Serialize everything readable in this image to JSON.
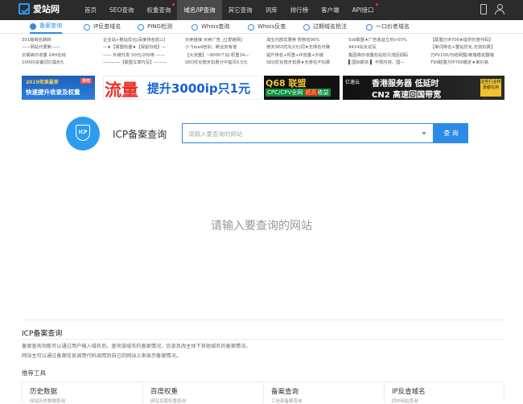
{
  "top_nav": {
    "logo_text": "爱站网",
    "items": [
      {
        "label": "首页",
        "active": false,
        "dot": false
      },
      {
        "label": "SEO查询",
        "active": false,
        "dot": false
      },
      {
        "label": "权重查询",
        "active": false,
        "dot": true
      },
      {
        "label": "域名/IP查询",
        "active": true,
        "dot": false
      },
      {
        "label": "其它查询",
        "active": false,
        "dot": false
      },
      {
        "label": "词库",
        "active": false,
        "dot": false
      },
      {
        "label": "排行榜",
        "active": false,
        "dot": false
      },
      {
        "label": "客户端",
        "active": false,
        "dot": false
      },
      {
        "label": "API接口",
        "active": false,
        "dot": true
      }
    ],
    "icons": [
      "phone-icon",
      "user-icon"
    ]
  },
  "sub_nav": {
    "items": [
      {
        "label": "备案查询",
        "active": true
      },
      {
        "label": "IP反查域名",
        "active": false
      },
      {
        "label": "PING检测",
        "active": false
      },
      {
        "label": "Whois查询",
        "active": false
      },
      {
        "label": "Whois反查",
        "active": false
      },
      {
        "label": "过期域名抢注",
        "active": false
      },
      {
        "label": "一口价老域名",
        "active": false
      }
    ]
  },
  "ad_links": {
    "columns": [
      [
        "301敞域名跳转",
        "——网站代更新——",
        "长期高价收量 24H在线",
        "10000关键词只需8元"
      ],
      [
        "企业站+整站优化[百度排名前三]",
        "—★【联盟收量★【保留日结】—",
        "—— 外链代发 50元/200条 ——",
        "————【联盟文章代写】———"
      ],
      [
        "买卖链接 买卖广告 上[爱链网]",
        "小飞lead培训、刷业务有道",
        "【大流量】~8000个站-权重34—",
        "SEO优化按天扣费分中首页0.5元"
      ],
      [
        "淘宝内部优惠券 购物省90%",
        "按天SEO优化2元/词★无排名可赚",
        "提升排名+权重+IP流量+外链",
        "SEO优化按天扣费★无排名不扣费"
      ],
      [
        "5s9联盟★广告收益立刻+50%",
        "4414站长论坛",
        "集团高价收量包站包引流回调码",
        "▌国际期货 ▌ 不限内容、国—"
      ],
      [
        "【联盟万IP700★提供托管代码】",
        "【单词排名+整站优化,无效扣费】",
        "万PV100/日结网盟/被墙稳定翻墙",
        "T99联盟万IP700稳定★单价高"
      ]
    ]
  },
  "banners": {
    "b1": {
      "line1": "2019效果最差",
      "tag": "推荐",
      "line2": "快速提升收录及权重"
    },
    "b2": {
      "big": "流量",
      "text": "提升3000ip只1元"
    },
    "b3": {
      "title_a": "Q68",
      "title_b": "联盟",
      "sub": "CPC/CPV全网",
      "sub_hl": "超高",
      "sub_end": "收益"
    },
    "b4": {
      "logo": "亿速云",
      "line1": "香港服务器 低延时",
      "line2": "CN2 高速回国带宽",
      "badge": "这些行业特惠都在用"
    }
  },
  "search": {
    "logo_text": "ICP",
    "title": "ICP备案查询",
    "placeholder": "请输入要查询的网站",
    "button": "查 询"
  },
  "empty_message": "请输入要查询的网站",
  "info": {
    "title": "ICP备案查询",
    "lines": [
      "备案查询功能可以通过用户输入域名后，查询该域名的备案情况，信息及改主体下其他域名的备案情况。",
      "网站主可以通过备案信息调用代码调用到自己的网站上来显示备案情况。"
    ]
  },
  "recommended": {
    "title": "推荐工具",
    "tools": [
      {
        "name": "历史数据",
        "desc": "网站历史数据查询"
      },
      {
        "name": "百度权重",
        "desc": "网站百度权重查询"
      },
      {
        "name": "备案查询",
        "desc": "工信部备案查询"
      },
      {
        "name": "IP反查域名",
        "desc": "同IP网站查询"
      }
    ]
  }
}
